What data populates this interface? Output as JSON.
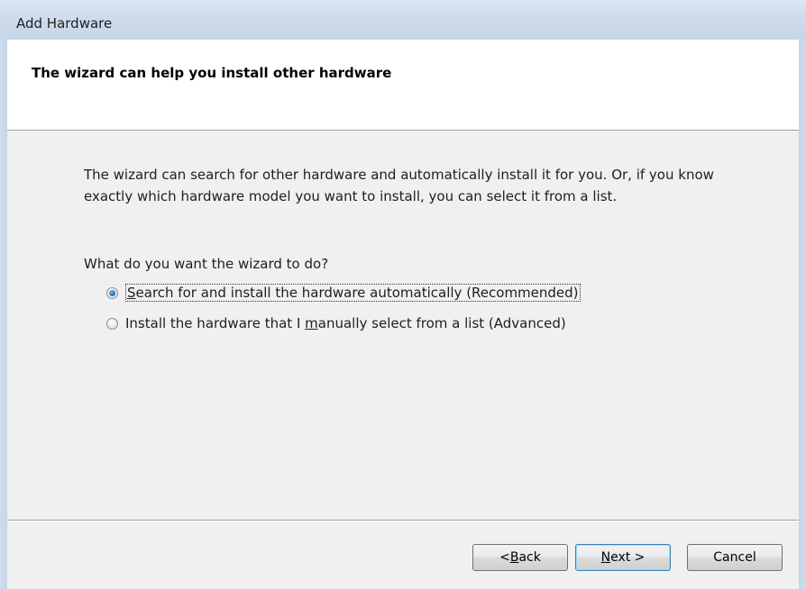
{
  "window": {
    "title": "Add Hardware"
  },
  "header": {
    "heading": "The wizard can help you install other hardware"
  },
  "body": {
    "description": "The wizard can search for other hardware and automatically install it for you. Or, if you know exactly which hardware model you want to install, you can select it from a list.",
    "question": "What do you want the wizard to do?",
    "options": [
      {
        "pre": "",
        "key": "S",
        "post": "earch for and install the hardware automatically (Recommended)",
        "checked": true
      },
      {
        "pre": "Install the hardware that I ",
        "key": "m",
        "post": "anually select from a list (Advanced)",
        "checked": false
      }
    ]
  },
  "buttons": {
    "back": {
      "pre": "< ",
      "key": "B",
      "post": "ack"
    },
    "next": {
      "pre": "",
      "key": "N",
      "post": "ext >"
    },
    "cancel": "Cancel"
  }
}
